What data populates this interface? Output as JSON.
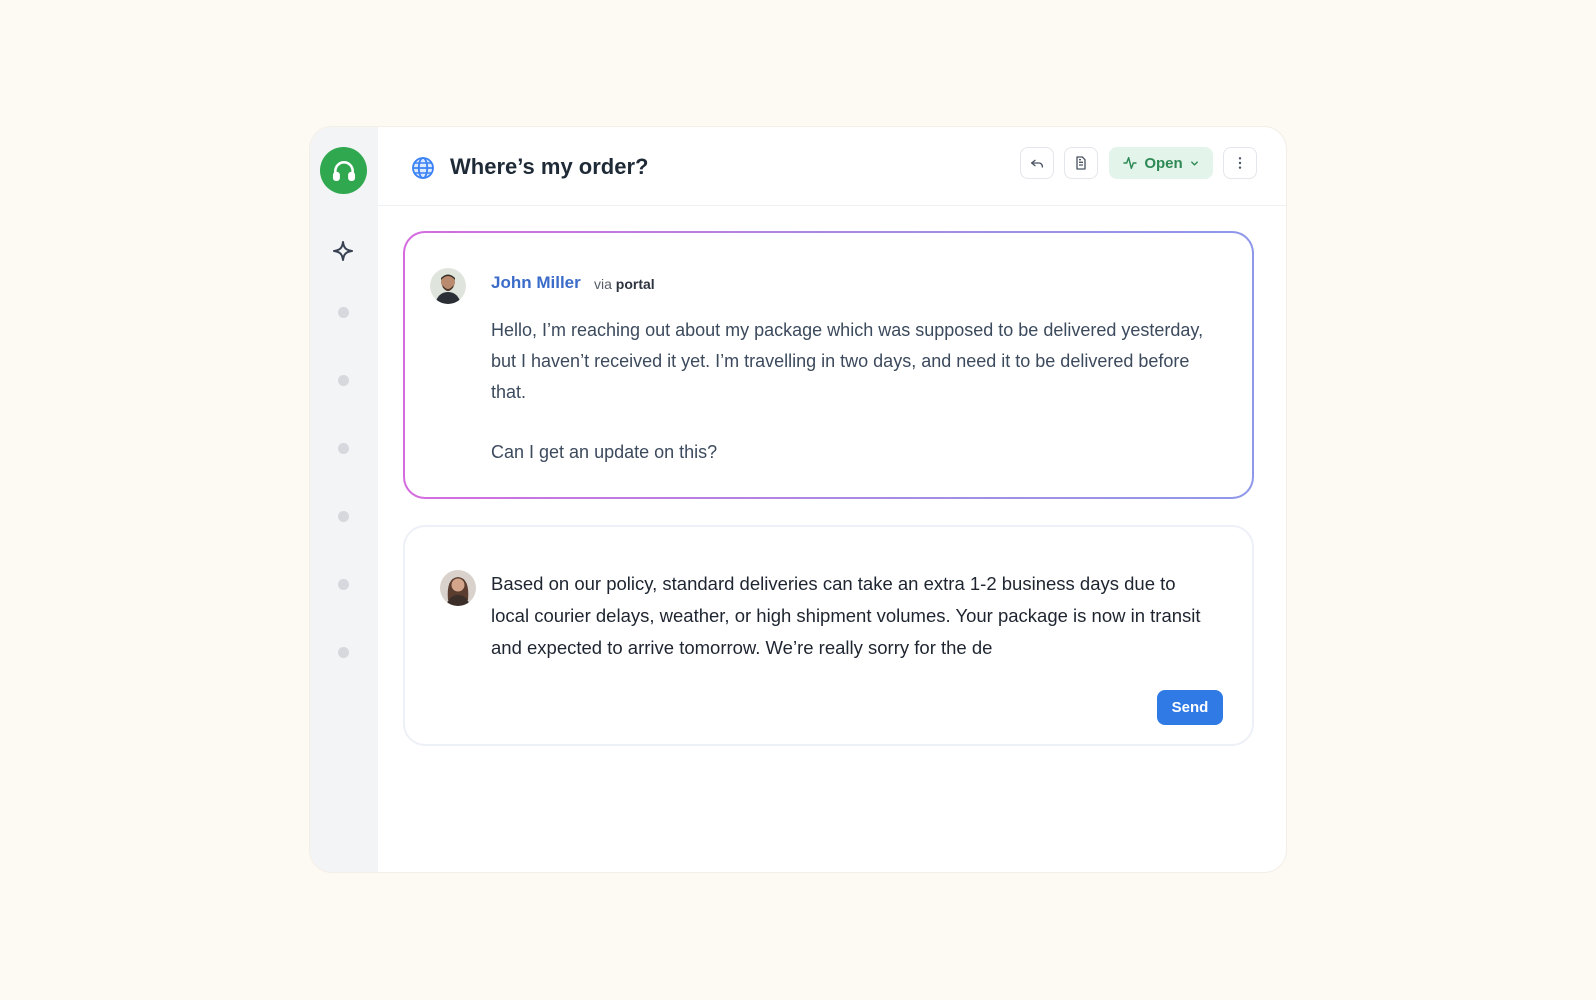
{
  "app": {
    "brand_color": "#2fa84f",
    "logo_icon": "headset-icon"
  },
  "header": {
    "title": "Where’s my order?",
    "channel_icon": "globe-icon",
    "status_label": "Open",
    "status_color": "#2e8a55"
  },
  "message": {
    "author": "John Miller",
    "via_prefix": "via",
    "via_channel": "portal",
    "paragraphs": [
      "Hello, I’m reaching out about my package which was supposed to be delivered yesterday, but I haven’t received it yet. I’m travelling in two days, and need it to be delivered before that.",
      "Can I get an update on this?"
    ]
  },
  "reply": {
    "draft_text": "Based on our policy, standard deliveries can take an extra 1-2 business days due to local courier delays, weather, or high shipment volumes. Your package is now in transit and expected to arrive tomorrow. We’re really sorry for the de",
    "send_label": "Send",
    "send_color": "#2f7ae5"
  }
}
